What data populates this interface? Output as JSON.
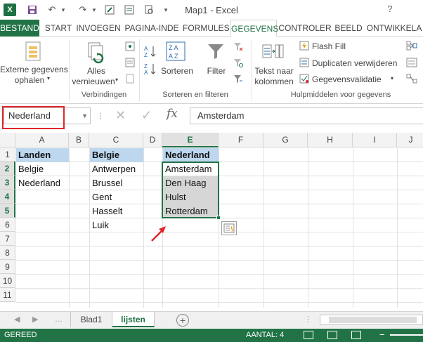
{
  "window": {
    "title": "Map1 - Excel",
    "help": "?"
  },
  "tabs": [
    {
      "label": "BESTAND"
    },
    {
      "label": "START"
    },
    {
      "label": "INVOEGEN"
    },
    {
      "label": "PAGINA-INDE"
    },
    {
      "label": "FORMULES"
    },
    {
      "label": "GEGEVENS"
    },
    {
      "label": "CONTROLER"
    },
    {
      "label": "BEELD"
    },
    {
      "label": "ONTWIKKELA"
    }
  ],
  "ribbon": {
    "external": {
      "line1": "Externe gegevens",
      "line2": "ophalen"
    },
    "refresh": {
      "line1": "Alles",
      "line2": "vernieuwen"
    },
    "group_connections": "Verbindingen",
    "sort": "Sorteren",
    "filter": "Filter",
    "group_sort": "Sorteren en filteren",
    "text_to_columns": {
      "line1": "Tekst naar",
      "line2": "kolommen"
    },
    "flash_fill": "Flash Fill",
    "remove_duplicates": "Duplicaten verwijderen",
    "validation": "Gegevensvalidatie",
    "group_tools": "Hulpmiddelen voor gegevens"
  },
  "formula_bar": {
    "name_box": "Nederland",
    "fx": "fx",
    "formula": "Amsterdam"
  },
  "grid": {
    "columns": [
      "A",
      "B",
      "C",
      "D",
      "E",
      "F",
      "G",
      "H",
      "I",
      "J"
    ],
    "rows": [
      "1",
      "2",
      "3",
      "4",
      "5",
      "6",
      "7",
      "8",
      "9",
      "10",
      "11"
    ],
    "cells": {
      "A1": "Landen",
      "A2": "Belgie",
      "A3": "Nederland",
      "C1": "Belgie",
      "C2": "Antwerpen",
      "C3": "Brussel",
      "C4": "Gent",
      "C5": "Hasselt",
      "C6": "Luik",
      "E1": "Nederland",
      "E2": "Amsterdam",
      "E3": "Den Haag",
      "E4": "Hulst",
      "E5": "Rotterdam"
    }
  },
  "sheets": [
    {
      "label": "Blad1"
    },
    {
      "label": "lijsten"
    }
  ],
  "status": {
    "ready": "GEREED",
    "count": "AANTAL: 4"
  },
  "colors": {
    "excel_green": "#217346",
    "header_fill": "#bdd7ee",
    "highlight_red": "#e0262a"
  }
}
